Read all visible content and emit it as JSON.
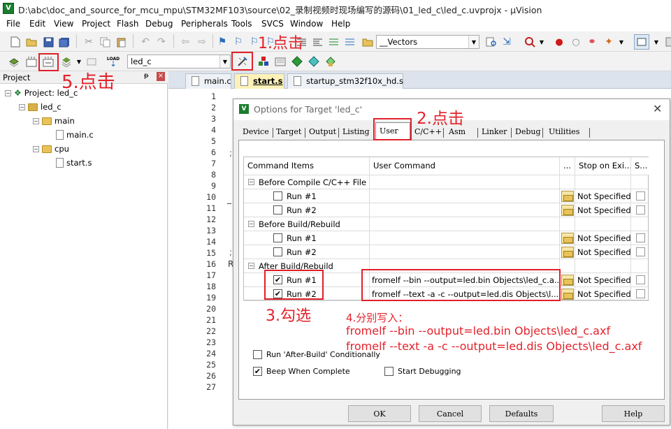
{
  "window": {
    "title": "D:\\abc\\doc_and_source_for_mcu_mpu\\STM32MF103\\source\\02_录制视频时现场编写的源码\\01_led_c\\led_c.uvprojx - µVision"
  },
  "menu": [
    "File",
    "Edit",
    "View",
    "Project",
    "Flash",
    "Debug",
    "Peripherals",
    "Tools",
    "SVCS",
    "Window",
    "Help"
  ],
  "toolbar": {
    "function_combo": "__Vectors",
    "target_combo": "led_c",
    "load_label": "LOAD"
  },
  "project": {
    "header": "Project",
    "pin": "ᵽ",
    "close": "×",
    "tree": [
      {
        "label": "Project: led_c"
      },
      {
        "label": "led_c"
      },
      {
        "label": "main"
      },
      {
        "label": "main.c"
      },
      {
        "label": "cpu"
      },
      {
        "label": "start.s"
      }
    ]
  },
  "editor": {
    "tabs": [
      "main.c",
      "start.s",
      "startup_stm32f10x_hd.s"
    ],
    "line_numbers": [
      "1",
      "2",
      "3",
      "4",
      "5",
      "6",
      "7",
      "8",
      "9",
      "10",
      "11",
      "12",
      "13",
      "14",
      "15",
      "16",
      "17",
      "18",
      "19",
      "20",
      "21",
      "22",
      "23",
      "24",
      "25",
      "26",
      "27"
    ],
    "fragments": [
      ";",
      "_",
      ";",
      "R"
    ]
  },
  "dialog": {
    "title": "Options for Target 'led_c'",
    "close": "✕",
    "tabs": [
      "Device",
      "Target",
      "Output",
      "Listing",
      "User",
      "C/C++",
      "Asm",
      "Linker",
      "Debug",
      "Utilities"
    ],
    "grid": {
      "headers": [
        "Command Items",
        "User Command",
        "...",
        "Stop on Exi...",
        "S..."
      ],
      "rows": [
        {
          "label": "Before Compile C/C++ File",
          "group": true
        },
        {
          "label": "Run #1",
          "checked": false,
          "command": "",
          "stop": "Not Specified"
        },
        {
          "label": "Run #2",
          "checked": false,
          "command": "",
          "stop": "Not Specified"
        },
        {
          "label": "Before Build/Rebuild",
          "group": true
        },
        {
          "label": "Run #1",
          "checked": false,
          "command": "",
          "stop": "Not Specified"
        },
        {
          "label": "Run #2",
          "checked": false,
          "command": "",
          "stop": "Not Specified"
        },
        {
          "label": "After Build/Rebuild",
          "group": true
        },
        {
          "label": "Run #1",
          "checked": true,
          "command": "fromelf  --bin  --output=led.bin  Objects\\led_c.a...",
          "stop": "Not Specified"
        },
        {
          "label": "Run #2",
          "checked": true,
          "command": "fromelf  --text  -a -c  --output=led.dis  Objects\\l...",
          "stop": "Not Specified"
        }
      ]
    },
    "options": {
      "run_after_build": "Run 'After-Build' Conditionally",
      "beep": "Beep When Complete",
      "start_debugging": "Start Debugging"
    },
    "buttons": {
      "ok": "OK",
      "cancel": "Cancel",
      "defaults": "Defaults",
      "help": "Help"
    }
  },
  "annotations": {
    "step1": "1.点击",
    "step2": "2.点击",
    "step3": "3.勾选",
    "step4": [
      "4.分别写入：",
      "fromelf  --bin  --output=led.bin  Objects\\led_c.axf",
      "fromelf  --text  -a -c  --output=led.dis  Objects\\led_c.axf"
    ],
    "step5": "5.点击"
  },
  "colors": {
    "annotation": "#e3222b",
    "active_tab": "#fdf1b8",
    "check": "#000000"
  }
}
